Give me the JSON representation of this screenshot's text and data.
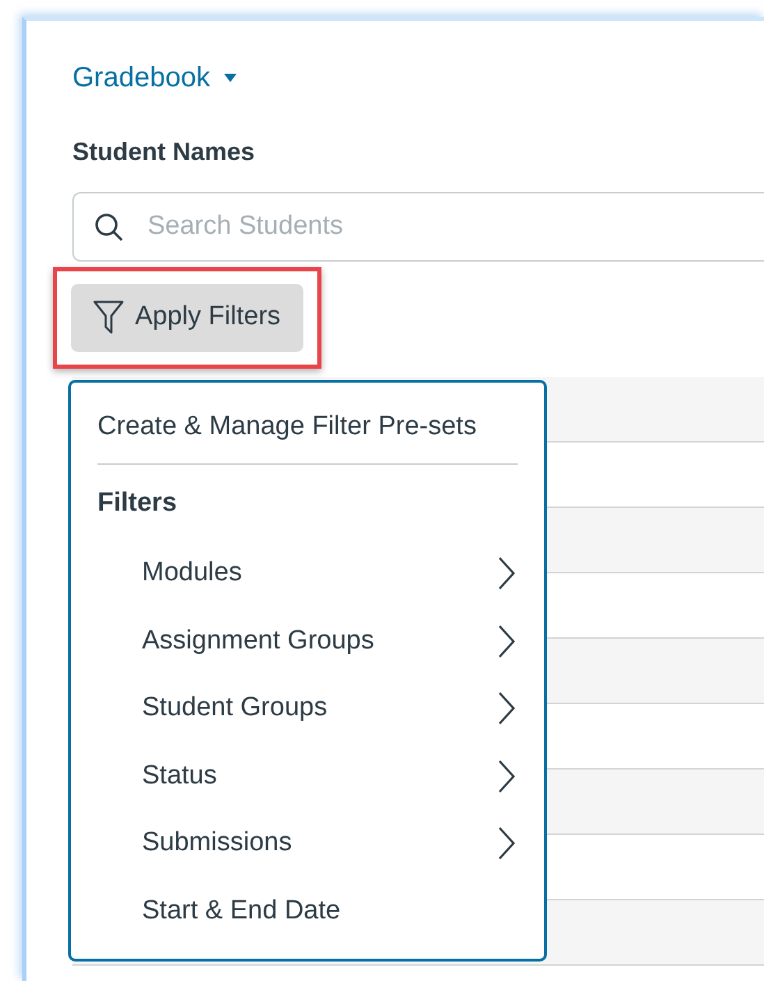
{
  "breadcrumb": {
    "label": "Gradebook"
  },
  "student_column": {
    "heading": "Student Names"
  },
  "search": {
    "placeholder": "Search Students"
  },
  "filter_button": {
    "label": "Apply Filters",
    "highlighted": true
  },
  "filter_menu": {
    "presets_item": "Create & Manage Filter Pre-sets",
    "section_heading": "Filters",
    "items": [
      {
        "label": "Modules",
        "has_submenu": true
      },
      {
        "label": "Assignment Groups",
        "has_submenu": true
      },
      {
        "label": "Student Groups",
        "has_submenu": true
      },
      {
        "label": "Status",
        "has_submenu": true
      },
      {
        "label": "Submissions",
        "has_submenu": true
      },
      {
        "label": "Start & End Date",
        "has_submenu": false
      }
    ]
  }
}
